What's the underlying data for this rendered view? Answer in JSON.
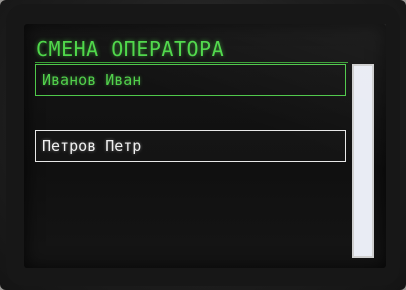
{
  "screen": {
    "title": "СМЕНА ОПЕРАТОРА",
    "operators": [
      {
        "name": "Иванов Иван",
        "state": "current"
      },
      {
        "name": "Петров Петр",
        "state": "selected"
      }
    ]
  },
  "colors": {
    "accent": "#4fd84a",
    "selection": "#f0f0f0",
    "background": "#121212",
    "scrollbar": "#e9ecf4"
  }
}
